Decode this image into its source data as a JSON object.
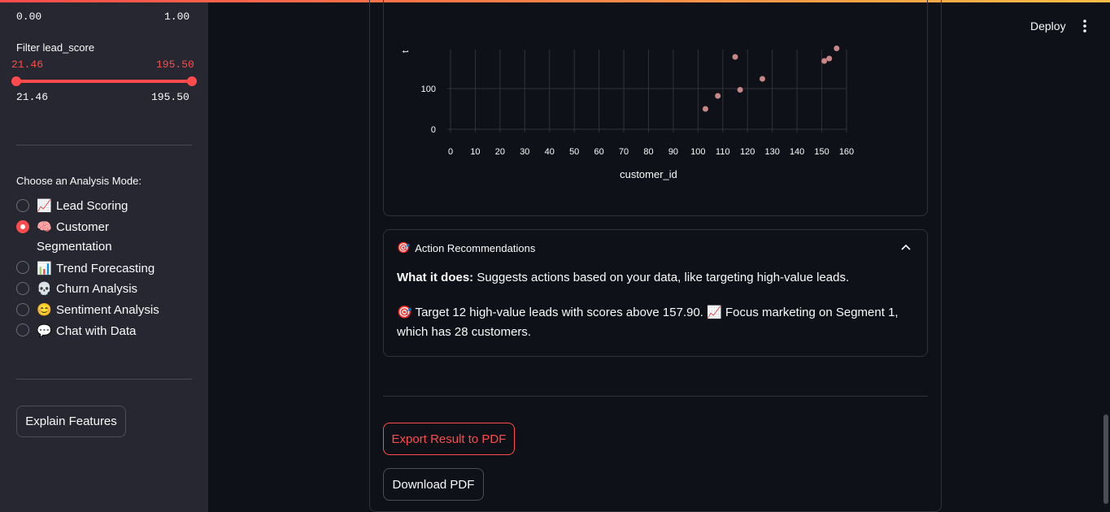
{
  "sidebar": {
    "prev_slider": {
      "min_label": "0.00",
      "max_label": "1.00"
    },
    "lead_slider": {
      "label": "Filter lead_score",
      "low_value": "21.46",
      "high_value": "195.50",
      "min_label": "21.46",
      "max_label": "195.50"
    },
    "mode_title": "Choose an Analysis Mode:",
    "modes": [
      {
        "emoji": "📈",
        "label": "Lead Scoring",
        "selected": false
      },
      {
        "emoji": "🧠",
        "label": "Customer",
        "label2": "Segmentation",
        "selected": true
      },
      {
        "emoji": "📊",
        "label": "Trend Forecasting",
        "selected": false
      },
      {
        "emoji": "💀",
        "label": "Churn Analysis",
        "selected": false
      },
      {
        "emoji": "😊",
        "label": "Sentiment Analysis",
        "selected": false
      },
      {
        "emoji": "💬",
        "label": "Chat with Data",
        "selected": false
      }
    ],
    "explain_button": "Explain Features"
  },
  "header": {
    "deploy_label": "Deploy",
    "menu_icon": "kebab-menu-icon"
  },
  "chart_data": {
    "type": "scatter",
    "xlabel": "customer_id",
    "ylabel_partial": "t",
    "x_ticks": [
      "0",
      "10",
      "20",
      "30",
      "40",
      "50",
      "60",
      "70",
      "80",
      "90",
      "100",
      "110",
      "120",
      "130",
      "140",
      "150",
      "160"
    ],
    "y_ticks": [
      "0",
      "100"
    ],
    "xlim": [
      0,
      160
    ],
    "ylim_visible": [
      0,
      200
    ],
    "point_color": "#c98686",
    "points": [
      {
        "x": 103,
        "y": 50
      },
      {
        "x": 108,
        "y": 82
      },
      {
        "x": 115,
        "y": 178
      },
      {
        "x": 117,
        "y": 97
      },
      {
        "x": 126,
        "y": 124
      },
      {
        "x": 151,
        "y": 168
      },
      {
        "x": 153,
        "y": 174
      },
      {
        "x": 156,
        "y": 199
      }
    ]
  },
  "recommendations": {
    "emoji": "🎯",
    "title": "Action Recommendations",
    "chevron_icon": "chevron-up-icon",
    "what_label": "What it does:",
    "what_text": " Suggests actions based on your data, like targeting high-value leads.",
    "line1": "🎯 Target 12 high-value leads with scores above 157.90. 📈 Focus marketing on Segment 1,",
    "line2": "which has 28 customers."
  },
  "actions": {
    "export_label": "Export Result to PDF",
    "download_label": "Download PDF"
  },
  "colors": {
    "accent": "#ff4b4b",
    "background": "#0e1117",
    "sidebar": "#262730"
  }
}
